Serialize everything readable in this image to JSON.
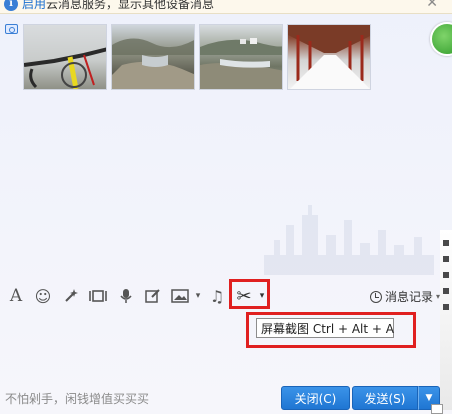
{
  "notice": {
    "enable_text": "启用",
    "message": "云消息服务，显示其他设备消息",
    "close_glyph": "✕"
  },
  "photos": [
    "photo-bicycle",
    "photo-river-rocks",
    "photo-river-village",
    "photo-covered-walkway"
  ],
  "toolbar": {
    "font_glyph": "A",
    "emoji_glyph": "☺",
    "music_glyph": "♫",
    "scissors_glyph": "✂",
    "caret_glyph": "▾",
    "history_label": "消息记录"
  },
  "tooltip": {
    "text": "屏幕截图 Ctrl + Alt + A"
  },
  "footer": {
    "ad_text": "不怕剁手，闲钱增值买买买",
    "close_label": "关闭(C)",
    "send_label": "发送(S)",
    "send_dropdown_glyph": "▼"
  },
  "colors": {
    "highlight": "#e02020",
    "button": "#1f76d3",
    "link": "#1a6fd0"
  }
}
